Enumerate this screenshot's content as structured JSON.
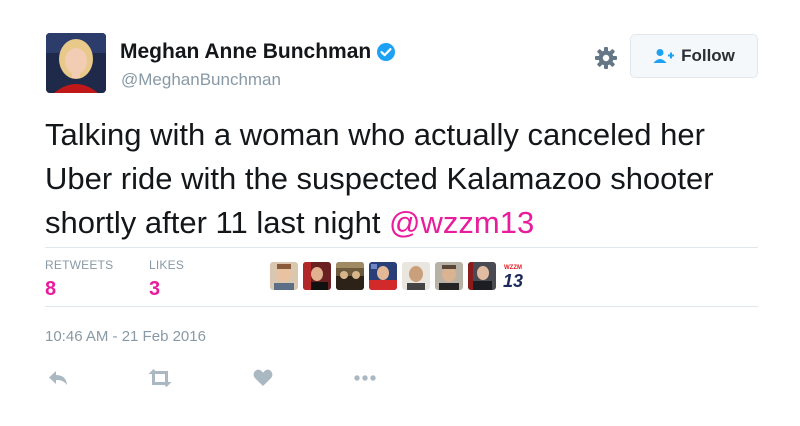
{
  "user": {
    "display_name": "Meghan Anne Bunchman",
    "handle": "@MeghanBunchman",
    "verified": true
  },
  "header": {
    "follow_label": "Follow",
    "settings_icon": "gear-icon"
  },
  "tweet": {
    "text": "Talking with a woman who actually canceled her Uber ride with the suspected Kalamazoo shooter shortly after 11 last night ",
    "mention": "@wzzm13",
    "timestamp": "10:46 AM - 21 Feb 2016"
  },
  "stats": {
    "retweets_label": "RETWEETS",
    "retweets_count": "8",
    "likes_label": "LIKES",
    "likes_count": "3"
  },
  "likers": {
    "logo_text_top": "WZZM",
    "logo_text_main": "13"
  },
  "actions": {
    "reply_icon": "reply-icon",
    "retweet_icon": "retweet-icon",
    "like_icon": "heart-icon",
    "more_icon": "more-icon"
  },
  "colors": {
    "accent": "#e81c9c",
    "muted": "#8899a6",
    "verified_blue": "#1da1f2"
  }
}
